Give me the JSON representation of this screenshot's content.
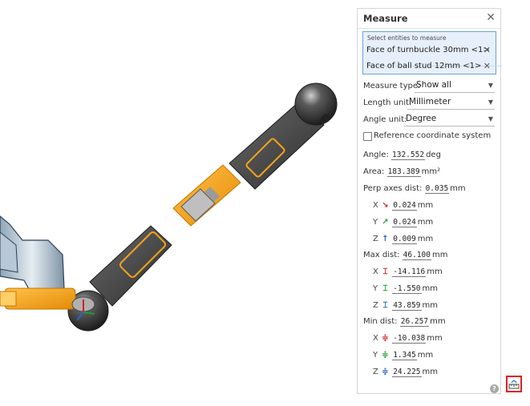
{
  "panel": {
    "title": "Measure",
    "selection": {
      "caption": "Select entities to measure",
      "items": [
        "Face of turnbuckle 30mm <1>",
        "Face of ball stud 12mm <1>"
      ]
    },
    "measure_type": {
      "label": "Measure type:",
      "value": "Show all"
    },
    "length_unit": {
      "label": "Length unit:",
      "value": "Millimeter"
    },
    "angle_unit": {
      "label": "Angle unit:",
      "value": "Degree"
    },
    "reference_cs": {
      "label": "Reference coordinate system",
      "checked": false
    },
    "angle": {
      "label": "Angle:",
      "value": "132.552",
      "unit": "deg"
    },
    "area": {
      "label": "Area:",
      "value": "183.389",
      "unit": "mm²"
    },
    "perp": {
      "label": "Perp axes dist:",
      "value": "0.035",
      "unit": "mm",
      "x": "0.024",
      "y": "0.024",
      "z": "0.009",
      "unit_sub": "mm"
    },
    "max": {
      "label": "Max dist:",
      "value": "46.100",
      "unit": "mm",
      "x": "-14.116",
      "y": "-1.550",
      "z": "43.859",
      "unit_sub": "mm"
    },
    "min": {
      "label": "Min dist:",
      "value": "26.257",
      "unit": "mm",
      "x": "-10.038",
      "y": "1.345",
      "z": "24.225",
      "unit_sub": "mm"
    },
    "axis_labels": {
      "x": "X",
      "y": "Y",
      "z": "Z"
    }
  },
  "icons": [
    "close-icon",
    "remove-icon",
    "chevron-down-icon",
    "checkbox-icon",
    "help-icon",
    "measure-tool-icon",
    "x-arrow-icon",
    "y-arrow-icon",
    "z-arrow-icon"
  ],
  "colors": {
    "accent": "#6aa5d6",
    "highlight_orange": "#f5a31a",
    "x_axis": "#d32020",
    "y_axis": "#1f9e2f",
    "z_axis": "#2b66c3",
    "tool_border": "#e12020"
  }
}
